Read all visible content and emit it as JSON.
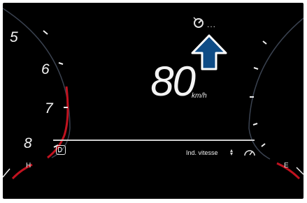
{
  "tachometer": {
    "labels": [
      "5",
      "6",
      "7",
      "8"
    ]
  },
  "speed": {
    "value": "80",
    "unit": "km/h"
  },
  "status": {
    "icon": "cruise-control-icon",
    "dots": "..."
  },
  "menu": {
    "label": "Ind. vitesse",
    "selector": "▴\n▾"
  },
  "temperature": {
    "label": "H"
  },
  "fuel": {
    "label": "E"
  },
  "colors": {
    "redline": "#c1121f",
    "arrow_fill": "#0f4c86",
    "arrow_stroke": "#ffffff"
  }
}
